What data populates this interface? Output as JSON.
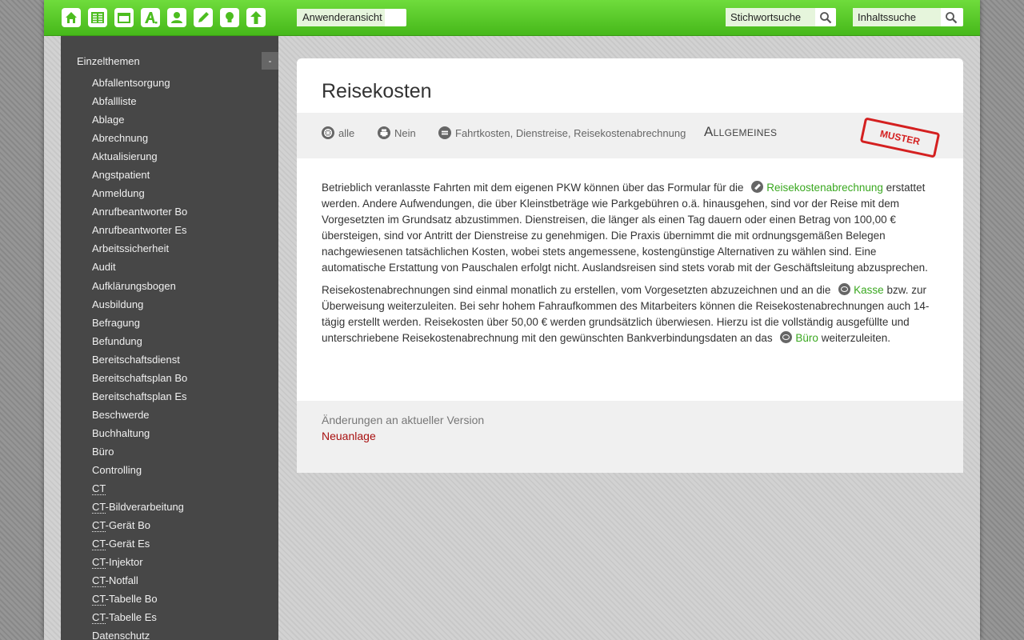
{
  "toolbar": {
    "nav_icons": [
      "home-icon",
      "table-icon",
      "folder-icon",
      "font-icon",
      "user-icon",
      "pencil-icon",
      "lightbulb-icon",
      "arrow-up-icon"
    ],
    "view_select": "Anwenderansicht",
    "keyword_search": "Stichwortsuche",
    "content_search": "Inhaltssuche"
  },
  "sidebar": {
    "heading": "Einzelthemen",
    "collapse_label": "-",
    "items": [
      "Abfallentsorgung",
      "Abfallliste",
      "Ablage",
      "Abrechnung",
      "Aktualisierung",
      "Angstpatient",
      "Anmeldung",
      "Anrufbeantworter Bo",
      "Anrufbeantworter Es",
      "Arbeitssicherheit",
      "Audit",
      "Aufklärungsbogen",
      "Ausbildung",
      "Befragung",
      "Befundung",
      "Bereitschaftsdienst",
      "Bereitschaftsplan Bo",
      "Bereitschaftsplan Es",
      "Beschwerde",
      "Buchhaltung",
      "Büro",
      "Controlling",
      "CT",
      "CT-Bildverarbeitung",
      "CT-Gerät Bo",
      "CT-Gerät Es",
      "CT-Injektor",
      "CT-Notfall",
      "CT-Tabelle Bo",
      "CT-Tabelle Es",
      "Datenschutz"
    ]
  },
  "document": {
    "title": "Reisekosten",
    "meta": {
      "scope": "alle",
      "print": "Nein",
      "keywords": "Fahrtkosten, Dienstreise, Reisekostenabrechnung",
      "category": "Allgemeines",
      "stamp": "MUSTER"
    },
    "paragraph1": {
      "before_link": "Betrieblich veranlasste Fahrten mit dem eigenen PKW können über das Formular für die",
      "link": "Reisekostenabrechnung",
      "after_link": "erstattet werden. Andere Aufwendungen, die über Kleinstbeträge wie Parkgebühren o.ä. hinausgehen, sind vor der Reise mit dem Vorgesetzten im Grundsatz abzustimmen. Dienstreisen, die länger als einen Tag dauern oder einen Betrag von 100,00 € übersteigen, sind vor Antritt der Dienstreise zu genehmigen. Die Praxis übernimmt die mit ordnungsgemäßen Belegen nachgewiesenen tatsächlichen Kosten, wobei stets angemessene, kostengünstige Alternativen zu wählen sind. Eine automatische Erstattung von Pauschalen erfolgt nicht. Auslandsreisen sind stets vorab mit der Geschäftsleitung abzusprechen."
    },
    "paragraph2": {
      "before_link": "Reisekostenabrechnungen sind einmal monatlich zu erstellen, vom Vorgesetzten abzuzeichnen und an die",
      "link1": "Kasse",
      "middle": "bzw. zur Überweisung weiterzuleiten. Bei sehr hohem Fahraufkommen des Mitarbeiters können die Reisekostenabrechnungen auch 14-tägig erstellt werden. Reisekosten über 50,00 € werden grundsätzlich überwiesen. Hierzu ist die vollständig ausgefüllte und unterschriebene Reisekostenabrechnung mit den gewünschten Bankverbindungsdaten an das",
      "link2": "Büro",
      "after_link": "weiterzuleiten."
    },
    "changes": {
      "heading": "Änderungen an aktueller Version",
      "value": "Neuanlage"
    }
  }
}
